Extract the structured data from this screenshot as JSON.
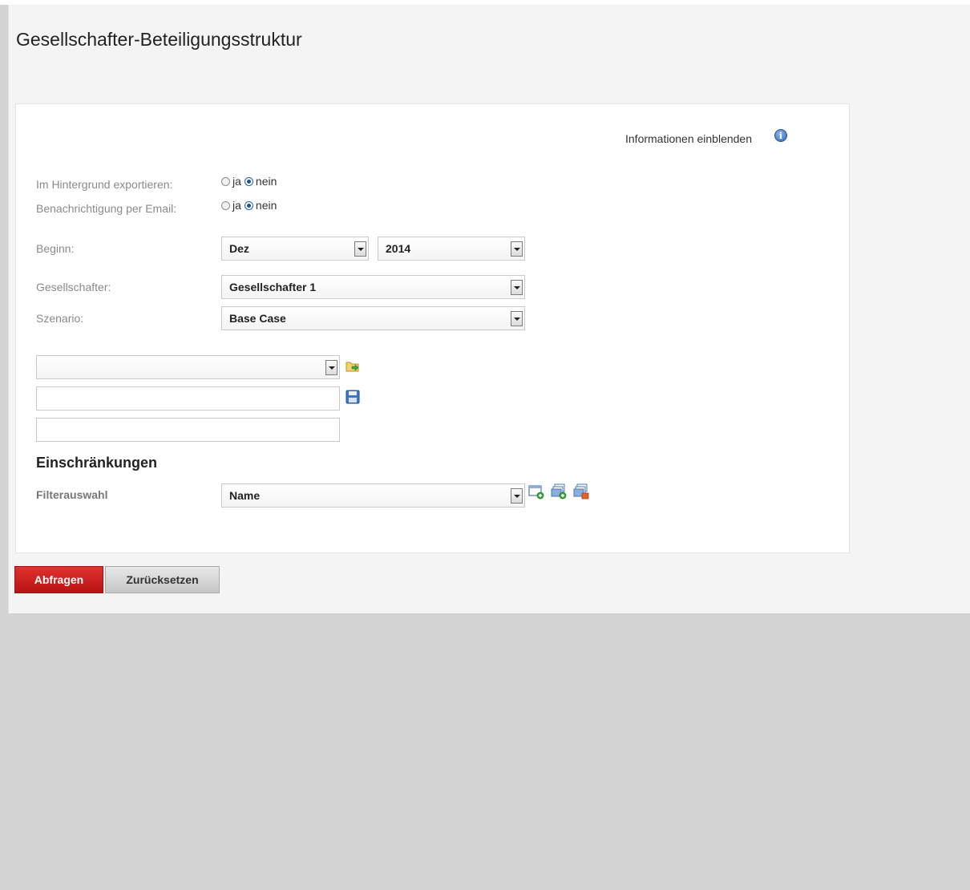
{
  "page": {
    "title": "Gesellschafter-Beteiligungsstruktur"
  },
  "info": {
    "label": "Informationen einblenden",
    "icon": "info-icon"
  },
  "options": {
    "background_export": {
      "label": "Im Hintergrund exportieren:",
      "choices": [
        "ja",
        "nein"
      ],
      "selected": "nein"
    },
    "email_notification": {
      "label": "Benachrichtigung per Email:",
      "choices": [
        "ja",
        "nein"
      ],
      "selected": "nein"
    }
  },
  "form": {
    "beginn": {
      "label": "Beginn:",
      "month": "Dez",
      "year": "2014"
    },
    "gesellschafter": {
      "label": "Gesellschafter:",
      "value": "Gesellschafter 1"
    },
    "szenario": {
      "label": "Szenario:",
      "value": "Base Case"
    }
  },
  "saved_query": {
    "select_value": "",
    "name_value": "",
    "description_value": "",
    "load_icon": "folder-arrow-icon",
    "save_icon": "floppy-disk-icon"
  },
  "restrictions": {
    "title": "Einschränkungen",
    "filter_label": "Filterauswahl",
    "filter_value": "Name",
    "icons": [
      "add-filter-icon",
      "add-filter-group-icon",
      "remove-filter-group-icon"
    ]
  },
  "buttons": {
    "submit": "Abfragen",
    "reset": "Zurücksetzen"
  },
  "colors": {
    "primary": "#c8201e",
    "page_bg": "#f4f4f4",
    "outer_bg": "#d3d3d3"
  }
}
